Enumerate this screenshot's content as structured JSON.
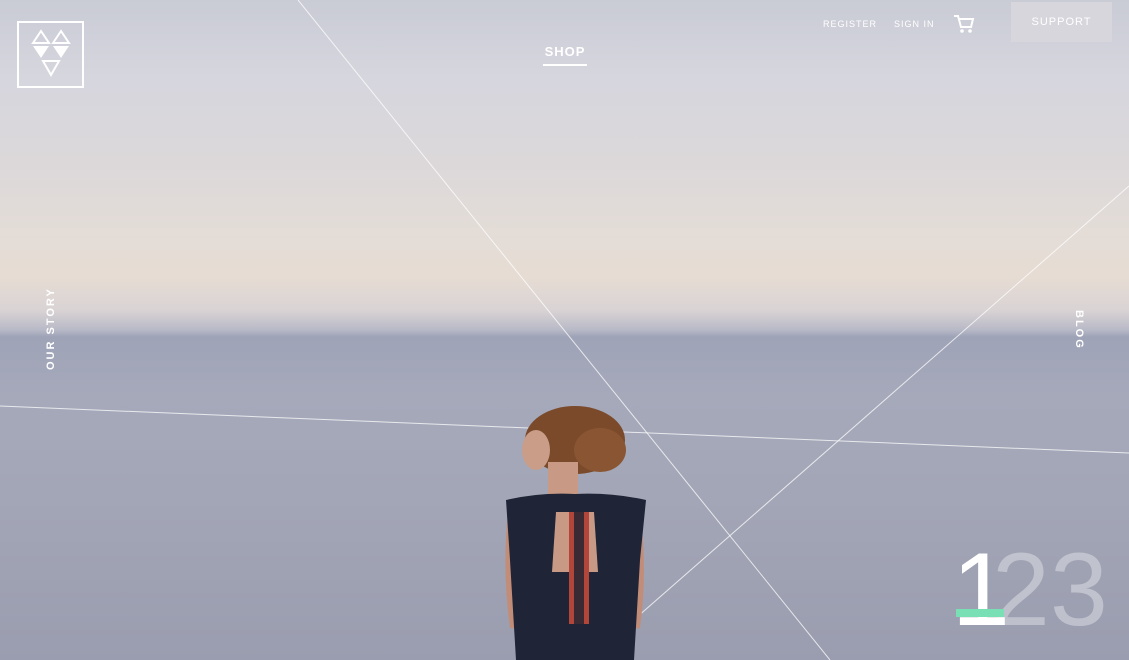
{
  "nav": {
    "shop": "SHOP",
    "register": "REGISTER",
    "sign_in": "SIGN IN",
    "support": "SUPPORT",
    "our_story": "OUR STORY",
    "blog": "BLOG"
  },
  "pager": {
    "pages": [
      "1",
      "2",
      "3"
    ],
    "active": "1",
    "accent_color": "#79e0b6"
  },
  "icons": {
    "logo": "triangle-heart-logo",
    "cart": "cart-icon"
  }
}
